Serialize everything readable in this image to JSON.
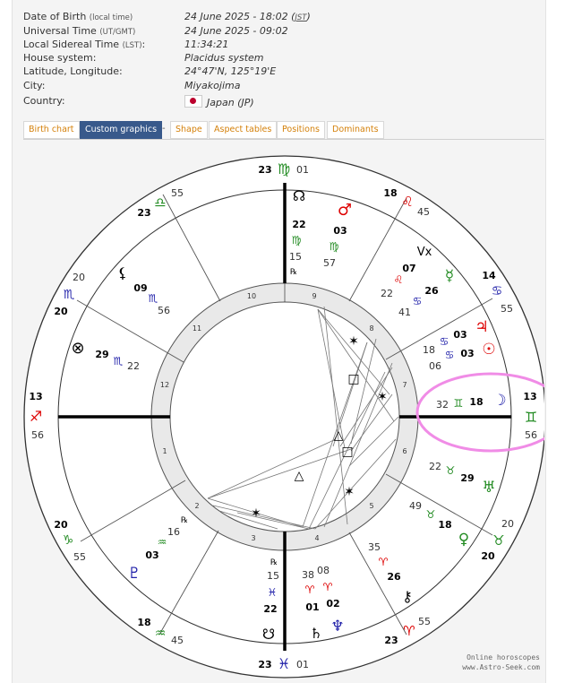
{
  "birth": [
    {
      "label": "Date of Birth",
      "note": "(local time)",
      "value": "24 June 2025 - 18:02",
      "value_note": "JST"
    },
    {
      "label": "Universal Time",
      "note": "(UT/GMT)",
      "value": "24 June 2025 - 09:02"
    },
    {
      "label": "Local Sidereal Time",
      "note": "(LST)",
      "value": "11:34:21"
    },
    {
      "label": "House system:",
      "value": "Placidus system"
    },
    {
      "label": "Latitude, Longitude:",
      "value": "24°47'N, 125°19'E"
    },
    {
      "label": "City:",
      "value": "Miyakojima"
    },
    {
      "label": "Country:",
      "value": "Japan (JP)"
    }
  ],
  "tabs": [
    {
      "label": "Birth chart",
      "active": false
    },
    {
      "label": "Custom graphics",
      "active": true
    },
    {
      "label": "Shape",
      "active": false
    },
    {
      "label": "Aspect tables",
      "active": false
    },
    {
      "label": "Positions",
      "active": false
    },
    {
      "label": "Dominants",
      "active": false
    }
  ],
  "tab_separator": "-",
  "colors": {
    "active_tab": "#38598b",
    "tab_text": "#d4800a",
    "highlight": "#f08ce6",
    "fire": "#dd0000",
    "earth": "#228b22",
    "air": "#228b22",
    "water": "#2222aa"
  },
  "credit": [
    "Online horoscopes",
    "www.Astro-Seek.com"
  ],
  "wheel": {
    "cusps": [
      {
        "deg": "13",
        "sign": "♐",
        "min": "56",
        "sign_icon": "sagittarius-icon"
      },
      {
        "deg": "20",
        "sign": "♑",
        "min": "55",
        "sign_icon": "capricorn-icon"
      },
      {
        "deg": "18",
        "sign": "♒",
        "min": "45",
        "sign_icon": "aquarius-icon"
      },
      {
        "deg": "23",
        "sign": "♓",
        "min": "01",
        "sign_icon": "pisces-icon"
      },
      {
        "deg": "23",
        "sign": "♈",
        "min": "55",
        "sign_icon": "aries-icon"
      },
      {
        "deg": "20",
        "sign": "♉",
        "min": "20",
        "sign_icon": "taurus-icon"
      },
      {
        "deg": "13",
        "sign": "♊",
        "min": "56",
        "sign_icon": "gemini-icon"
      },
      {
        "deg": "14",
        "sign": "♋",
        "min": "55",
        "sign_icon": "cancer-icon"
      },
      {
        "deg": "18",
        "sign": "♌",
        "min": "45",
        "sign_icon": "leo-icon"
      },
      {
        "deg": "23",
        "sign": "♍",
        "min": "01",
        "sign_icon": "virgo-icon"
      },
      {
        "deg": "23",
        "sign": "♎",
        "min": "55",
        "sign_icon": "libra-icon"
      },
      {
        "deg": "20",
        "sign": "♏",
        "min": "20",
        "sign_icon": "scorpio-icon"
      }
    ],
    "house_numbers": [
      "1",
      "2",
      "3",
      "4",
      "5",
      "6",
      "7",
      "8",
      "9",
      "10",
      "11",
      "12"
    ],
    "planets": [
      {
        "name": "moon",
        "glyph": "☽",
        "deg": "18",
        "sign": "♊",
        "min": "32"
      },
      {
        "name": "sun",
        "glyph": "☉",
        "deg": "03",
        "sign": "♋",
        "min": "06"
      },
      {
        "name": "jupiter",
        "glyph": "♃",
        "deg": "03",
        "sign": "♋",
        "min": "18"
      },
      {
        "name": "mercury",
        "glyph": "☿",
        "deg": "26",
        "sign": "♋",
        "min": "41"
      },
      {
        "name": "vertex",
        "glyph": "Vx",
        "deg": "07",
        "sign": "♌",
        "min": "22"
      },
      {
        "name": "mars",
        "glyph": "♂",
        "deg": "03",
        "sign": "♍",
        "min": "57"
      },
      {
        "name": "north-node",
        "glyph": "☊",
        "deg": "22",
        "sign": "♍",
        "min": "15",
        "retro": "℞"
      },
      {
        "name": "lilith",
        "glyph": "⚸",
        "deg": "09",
        "sign": "♏",
        "min": "56"
      },
      {
        "name": "fortune",
        "glyph": "⊗",
        "deg": "29",
        "sign": "♏",
        "min": "22"
      },
      {
        "name": "pluto",
        "glyph": "♇",
        "deg": "03",
        "sign": "♒",
        "min": "16",
        "retro": "℞"
      },
      {
        "name": "south-node",
        "glyph": "☋",
        "deg": "22",
        "sign": "♓",
        "min": "15",
        "retro": "℞"
      },
      {
        "name": "saturn",
        "glyph": "♄",
        "deg": "01",
        "sign": "♈",
        "min": "38"
      },
      {
        "name": "neptune",
        "glyph": "♆",
        "deg": "02",
        "sign": "♈",
        "min": "08"
      },
      {
        "name": "chiron",
        "glyph": "⚷",
        "deg": "26",
        "sign": "♈",
        "min": "35"
      },
      {
        "name": "venus",
        "glyph": "♀",
        "deg": "18",
        "sign": "♉",
        "min": "49"
      },
      {
        "name": "uranus",
        "glyph": "♅",
        "deg": "29",
        "sign": "♉",
        "min": "22"
      }
    ],
    "aspect_symbols": [
      "✶",
      "□",
      "✶",
      "△",
      "□",
      "✶",
      "△",
      "✶"
    ]
  }
}
